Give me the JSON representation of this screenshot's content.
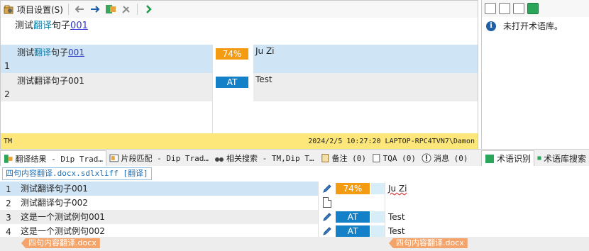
{
  "toolbar": {
    "project_settings_label": "项目设置(S)"
  },
  "source_line": {
    "part1": "测试",
    "part2": "翻译",
    "part3": "句子",
    "part4": "001"
  },
  "tm_results": [
    {
      "num": "1",
      "src_part1": "测试",
      "src_part2": "翻译",
      "src_part3": "句子",
      "src_part4": "001",
      "badge": "74%",
      "target": "Ju Zi"
    },
    {
      "num": "2",
      "src": "测试翻译句子001",
      "badge": "AT",
      "target": "Test"
    }
  ],
  "status_bar": {
    "left": "TM",
    "right": "2024/2/5 10:27:20 LAPTOP-RPC4TVN7\\Damon"
  },
  "termbase": {
    "message": "未打开术语库。"
  },
  "tabs": [
    {
      "label": "翻译结果 - Dip Trad…"
    },
    {
      "label": "片段匹配 - Dip Trad…"
    },
    {
      "label": "相关搜索 - TM,Dip T…"
    },
    {
      "label": "备注 (0)"
    },
    {
      "label": "TQA (0)"
    },
    {
      "label": "消息 (0)"
    },
    {
      "label": "术语识别"
    },
    {
      "label": "术语库搜索"
    }
  ],
  "file_tab": "四句内容翻译.docx.sdlxliff [翻译]",
  "segments": [
    {
      "num": "1",
      "source": "测试翻译句子001",
      "status": "74%",
      "target": "Ju Zi"
    },
    {
      "num": "2",
      "source": "测试翻译句子002",
      "status": "",
      "target": ""
    },
    {
      "num": "3",
      "source": "这是一个测试例句001",
      "status": "AT",
      "target": "Test"
    },
    {
      "num": "4",
      "source": "这是一个测试例句002",
      "status": "AT",
      "target": "Test"
    }
  ],
  "file_labels": {
    "source": "四句内容翻译.docx",
    "target": "四句内容翻译.docx"
  },
  "colors": {
    "accent_orange": "#f39c12",
    "accent_blue": "#1480c8",
    "status_bar": "#fde77a",
    "selected_row": "#cfe4f5"
  }
}
